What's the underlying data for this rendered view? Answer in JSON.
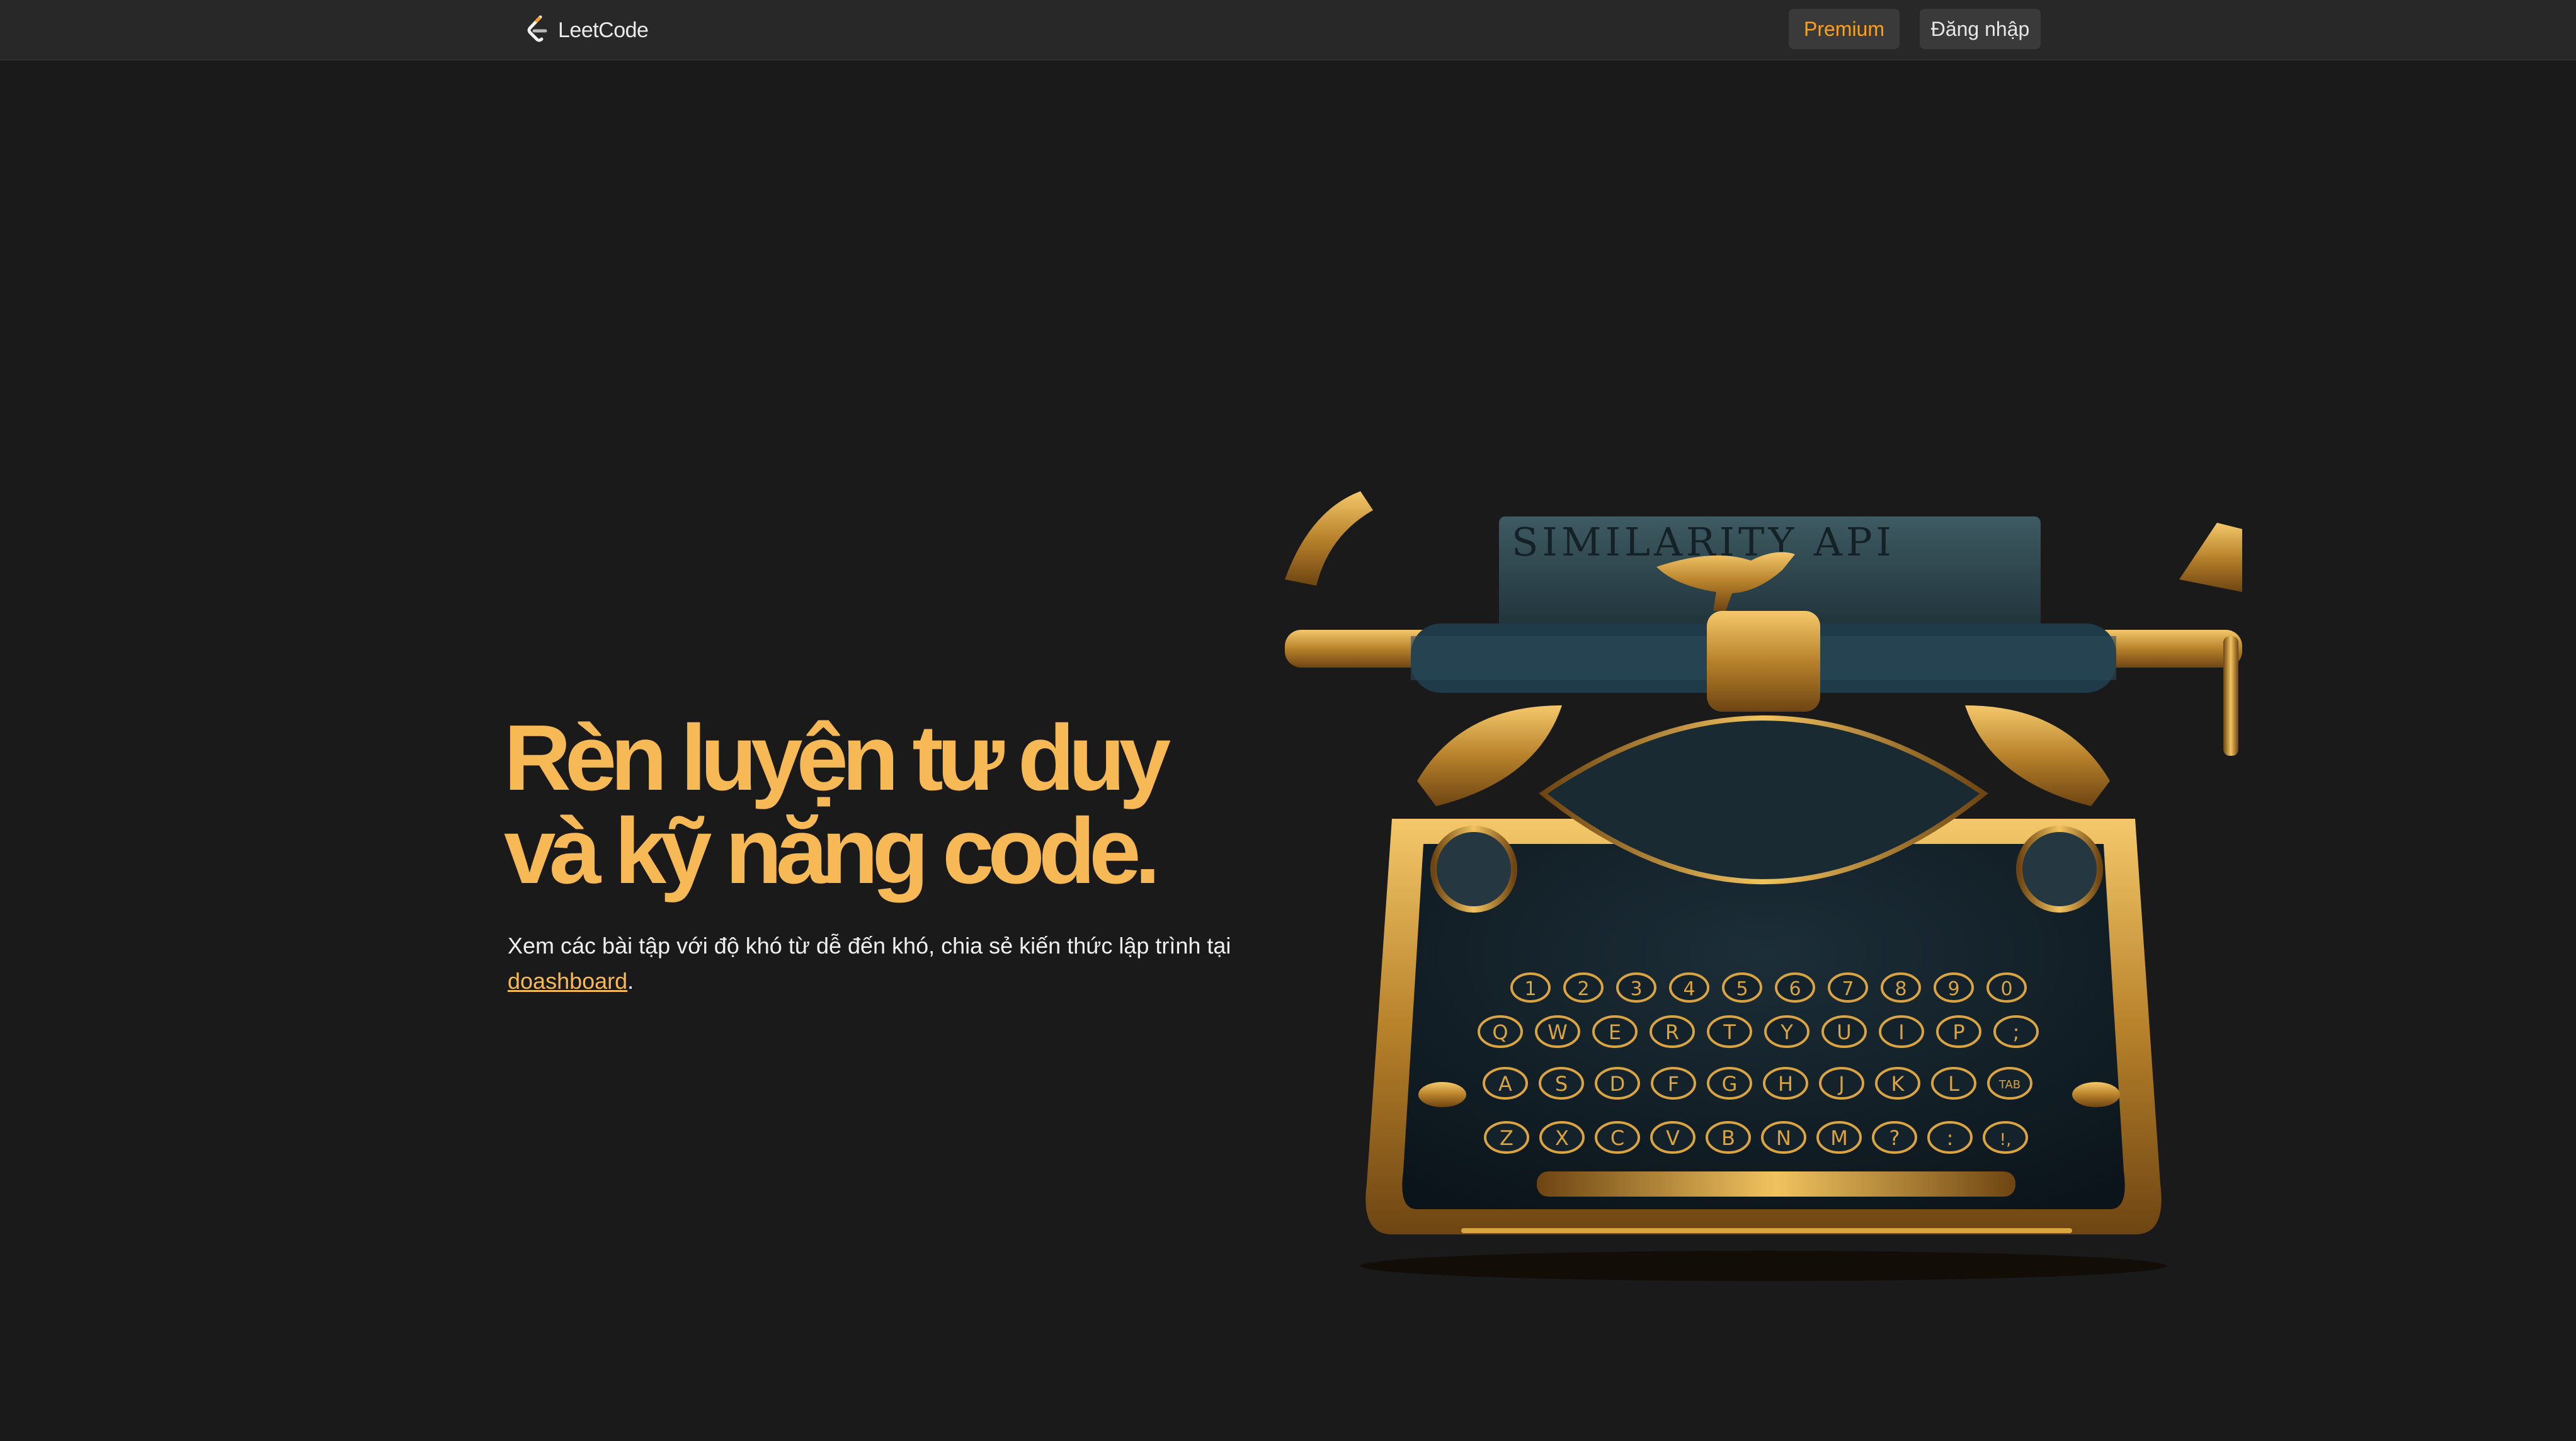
{
  "navbar": {
    "logo_text": "LeetCode",
    "premium_label": "Premium",
    "login_label": "Đăng nhập"
  },
  "hero": {
    "title_line1": "Rèn luyện tư duy",
    "title_line2": "và kỹ năng code.",
    "description": "Xem các bài tập với độ khó từ dễ đến khó, chia sẻ kiến thức lập trình tại ",
    "link_text": "doashboard",
    "description_end": "."
  },
  "illustration": {
    "paper_text": "SIMILARITY API",
    "key_row1": [
      "1",
      "2",
      "3",
      "4",
      "5",
      "6",
      "7",
      "8",
      "9",
      "0"
    ],
    "key_row2": [
      "Q",
      "W",
      "E",
      "R",
      "T",
      "Y",
      "U",
      "I",
      "P",
      ";"
    ],
    "key_row3": [
      "A",
      "S",
      "D",
      "F",
      "G",
      "H",
      "J",
      "K",
      "L",
      "TAB"
    ],
    "key_row4": [
      "Z",
      "X",
      "C",
      "V",
      "B",
      "N",
      "M",
      "?",
      ":",
      "!,"
    ]
  },
  "colors": {
    "background": "#1a1a1a",
    "navbar": "#282828",
    "accent": "#f7b955",
    "premium": "#ffa116",
    "gold": "#d9a441",
    "typewriter_dark": "#12202a"
  },
  "icons": {
    "logo": "leetcode-logo-icon",
    "illustration": "typewriter-illustration"
  }
}
